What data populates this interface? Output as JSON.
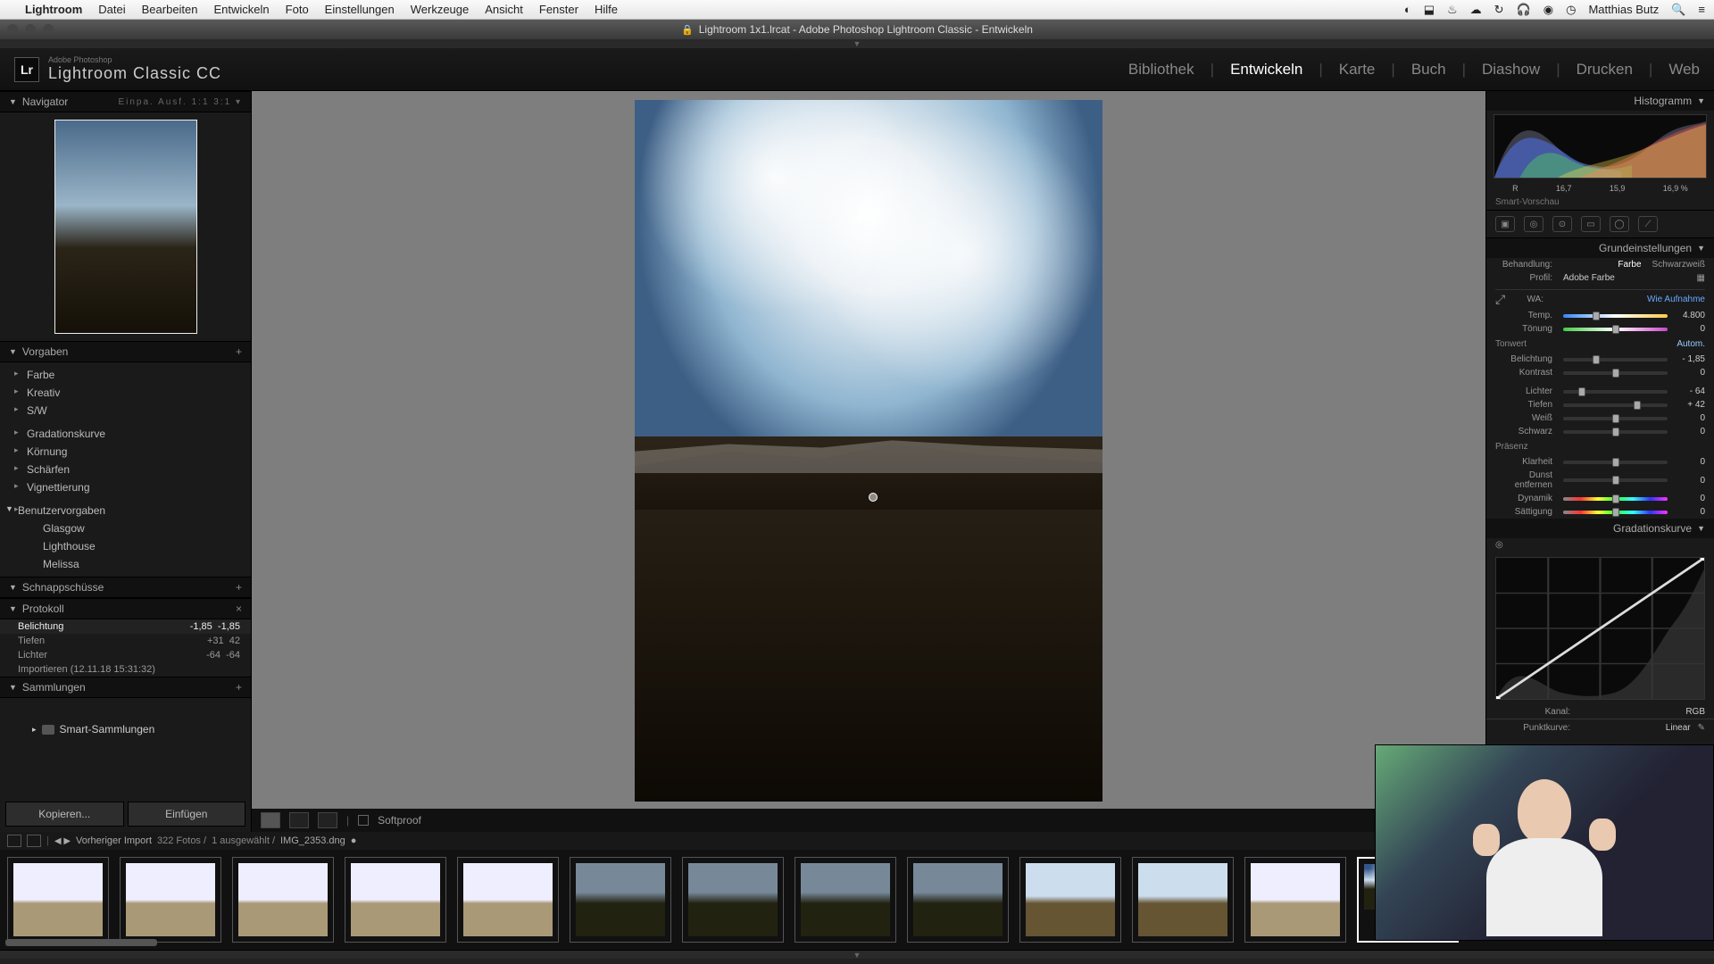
{
  "mac_menu": {
    "app": "Lightroom",
    "items": [
      "Datei",
      "Bearbeiten",
      "Entwickeln",
      "Foto",
      "Einstellungen",
      "Werkzeuge",
      "Ansicht",
      "Fenster",
      "Hilfe"
    ],
    "right": {
      "user": "Matthias Butz",
      "search": "🔍"
    }
  },
  "window_title": "Lightroom 1x1.lrcat - Adobe Photoshop Lightroom Classic - Entwickeln",
  "header": {
    "product_small": "Adobe Photoshop",
    "product": "Lightroom Classic CC",
    "modules": [
      "Bibliothek",
      "Entwickeln",
      "Karte",
      "Buch",
      "Diashow",
      "Drucken",
      "Web"
    ],
    "active_module": "Entwickeln"
  },
  "left": {
    "navigator": {
      "title": "Navigator",
      "zoom": "Einpa.",
      "opts": "Ausf.  1:1  3:1  ▾"
    },
    "presets": {
      "title": "Vorgaben",
      "groups": [
        "Farbe",
        "Kreativ",
        "S/W"
      ],
      "groups2": [
        "Gradationskurve",
        "Körnung",
        "Schärfen",
        "Vignettierung"
      ],
      "user_title": "Benutzervorgaben",
      "user": [
        "Glasgow",
        "Lighthouse",
        "Melissa"
      ]
    },
    "snapshots": {
      "title": "Schnappschüsse"
    },
    "history": {
      "title": "Protokoll",
      "items": [
        {
          "name": "Belichtung",
          "v1": "-1,85",
          "v2": "-1,85",
          "sel": true
        },
        {
          "name": "Tiefen",
          "v1": "+31",
          "v2": "42"
        },
        {
          "name": "Lichter",
          "v1": "-64",
          "v2": "-64"
        },
        {
          "name": "Importieren (12.11.18 15:31:32)",
          "v1": "",
          "v2": ""
        }
      ]
    },
    "collections": {
      "title": "Sammlungen",
      "smart": "Smart-Sammlungen"
    },
    "btn_copy": "Kopieren...",
    "btn_paste": "Einfügen"
  },
  "toolbar": {
    "softproof": "Softproof"
  },
  "right": {
    "histogram": {
      "title": "Histogramm",
      "vals": [
        "R",
        "16,7",
        "15,9",
        "16,9 %"
      ],
      "smart": "Smart-Vorschau"
    },
    "basic": {
      "title": "Grundeinstellungen",
      "treatment_label": "Behandlung:",
      "treat_color": "Farbe",
      "treat_bw": "Schwarzweiß",
      "profile_label": "Profil:",
      "profile": "Adobe Farbe",
      "wb_label": "WA:",
      "wb_value": "Wie Aufnahme",
      "temp_label": "Temp.",
      "temp": "4.800",
      "tint_label": "Tönung",
      "tint": "0",
      "tone_label": "Tonwert",
      "auto": "Autom.",
      "exposure_label": "Belichtung",
      "exposure": "- 1,85",
      "contrast_label": "Kontrast",
      "contrast": "0",
      "highlights_label": "Lichter",
      "highlights": "- 64",
      "shadows_label": "Tiefen",
      "shadows": "+ 42",
      "whites_label": "Weiß",
      "whites": "0",
      "blacks_label": "Schwarz",
      "blacks": "0",
      "presence_label": "Präsenz",
      "clarity_label": "Klarheit",
      "clarity": "0",
      "dehaze_label": "Dunst entfernen",
      "dehaze": "0",
      "vibrance_label": "Dynamik",
      "vibrance": "0",
      "saturation_label": "Sättigung",
      "saturation": "0"
    },
    "curve": {
      "title": "Gradationskurve",
      "channel_label": "Kanal:",
      "channel": "RGB",
      "pointcurve_label": "Punktkurve:",
      "pointcurve": "Linear"
    }
  },
  "filmstrip": {
    "path": "Vorheriger Import",
    "count": "322 Fotos /",
    "sel": "1 ausgewählt /",
    "file": "IMG_2353.dng"
  }
}
